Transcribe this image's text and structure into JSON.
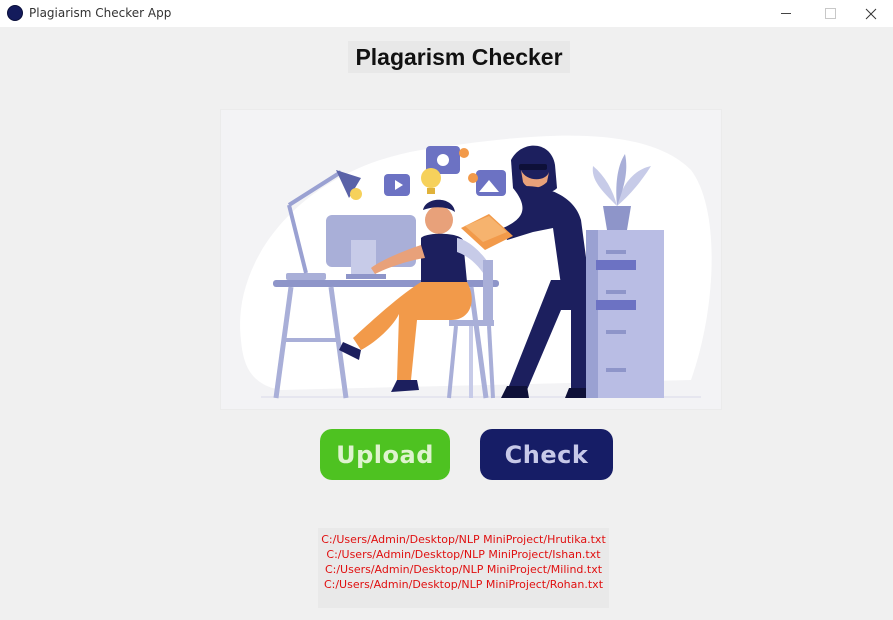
{
  "window": {
    "title": "Plagiarism Checker App",
    "icon": "app-circle-icon"
  },
  "main": {
    "heading": "Plagarism Checker",
    "illustration": "illustration-image"
  },
  "buttons": {
    "upload_label": "Upload",
    "check_label": "Check"
  },
  "files": [
    "C:/Users/Admin/Desktop/NLP MiniProject/Hrutika.txt",
    "C:/Users/Admin/Desktop/NLP MiniProject/Ishan.txt",
    "C:/Users/Admin/Desktop/NLP MiniProject/Milind.txt",
    "C:/Users/Admin/Desktop/NLP MiniProject/Rohan.txt"
  ],
  "colors": {
    "upload": "#4ec221",
    "check": "#161d66",
    "file_text": "#e01010"
  }
}
